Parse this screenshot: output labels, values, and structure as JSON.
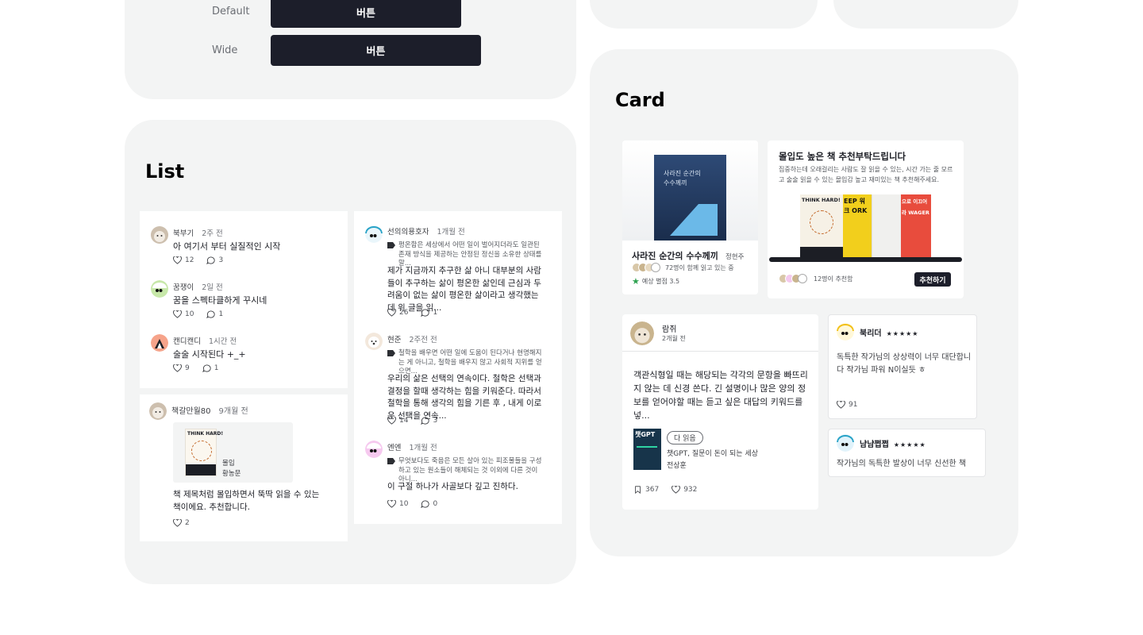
{
  "buttons": {
    "default_label": "Default",
    "default_text": "버튼",
    "wide_label": "Wide",
    "wide_text": "버튼"
  },
  "list": {
    "title": "List",
    "col1": [
      {
        "name": "북부기",
        "time": "2주 전",
        "text": "아 여기서 부터 실질적인 시작",
        "likes": "12",
        "comments": "3"
      },
      {
        "name": "꿈쟁이",
        "time": "2일 전",
        "text": "꿈을 스펙타클하게 꾸시네",
        "likes": "10",
        "comments": "1"
      },
      {
        "name": "캔디캔디",
        "time": "1시간 전",
        "text": "술술 시작된다 +_+",
        "likes": "9",
        "comments": "1"
      }
    ],
    "col1b": {
      "name": "책갈만월80",
      "time": "9개월 전",
      "book_title": "몰입",
      "book_author": "황농문",
      "cover_text": "THINK HARD!",
      "text": "책 제목처럼 몰입하면서 뚝딱 읽을 수 있는 책이에요. 추천합니다.",
      "likes": "2"
    },
    "col2": [
      {
        "name": "선의의용호자",
        "time": "1개월 전",
        "quote": "평온함은 세상에서 어떤 일이 벌어지더라도 일관된 존재 방식을 제공하는 안정된 정신을 소유한 상태를 말...",
        "text": "제가 지금까지 추구한 삶 아니 대부분의 사람들이 추구하는 삶이 평온한 삶인데 근심과 두려움이 없는 삶이 평온한 삶이라고 생각했는데 위 글을 읽...",
        "likes": "26",
        "comments": "1"
      },
      {
        "name": "현준",
        "time": "2주전 전",
        "quote": "철학을 배우면 어떤 일에 도움이 된다거나 현명해지는 게 아니고, 철학을 배우지 않고 사회적 지위를 얻으면...",
        "text": "우리의 삶은 선택의 연속이다. 철학은 선택과 결정을 할때 생각하는 힘을 키워준다. 따라서 철학을 통해 생각의 힘을 기른 후 , 내게 이로운 선택을 연속...",
        "likes": "14",
        "comments": "3"
      },
      {
        "name": "엔엔",
        "time": "1개월 전",
        "quote": "무엇보다도 죽음은 모든 살아 있는 피조물들을 구성하고 있는 원소들이 해체되는 것 이외에 다른 것이 아니...",
        "text": "이 구절 하나가 사골보다 깊고 진하다.",
        "likes": "10",
        "comments": "0"
      }
    ]
  },
  "card": {
    "title": "Card",
    "book": {
      "cover_line1": "사라진 순간의",
      "cover_line2": "수수께끼",
      "title": "사라진 순간의 수수께끼",
      "author": "정현주",
      "readers": "72명이 함께 읽고 있는 중",
      "rating": "예상 별점 3.5"
    },
    "reco": {
      "title": "몰입도 높은 책 추천부탁드립니다",
      "desc": "집중하는데 오래걸리는 사람도 잘 읽을 수 있는, 시간 가는 줄 모르고 술술 읽을 수 있는 몰입감 높고 재미있는 책 추천해주세요.",
      "cover1": "THINK HARD!",
      "cover2": "EEP 워크 ORK",
      "cover4": "으로 이끄어라 WAGER",
      "count": "12명이 추천함",
      "button": "추천하기"
    },
    "review": {
      "name": "람쥐",
      "time": "2개월 전",
      "text": "객관식형일 때는 해당되는 각각의 문항을 빠뜨리지 않는 데 신경 쓴다. 긴 설명이나 많은 양의 정보를 얻어야할 때는 듣고 싶은 대답의 키워드를 넣...",
      "chip": "다 읽음",
      "book_title": "챗GPT, 질문이 돈이 되는 세상",
      "book_author": "전상훈",
      "cover_text": "챗GPT",
      "bookmarks": "367",
      "likes": "932"
    },
    "mini1": {
      "name": "북리더",
      "stars": "★★★★★",
      "text": "독특한 작가님의 상상력이 너무 대단합니다 작가님 파워 N이실듯 ㅎ",
      "likes": "91"
    },
    "mini2": {
      "name": "냠냠쩝쩝",
      "stars": "★★★★★",
      "text": "작가님의 독특한 발상이 너무 신선한 책"
    }
  }
}
